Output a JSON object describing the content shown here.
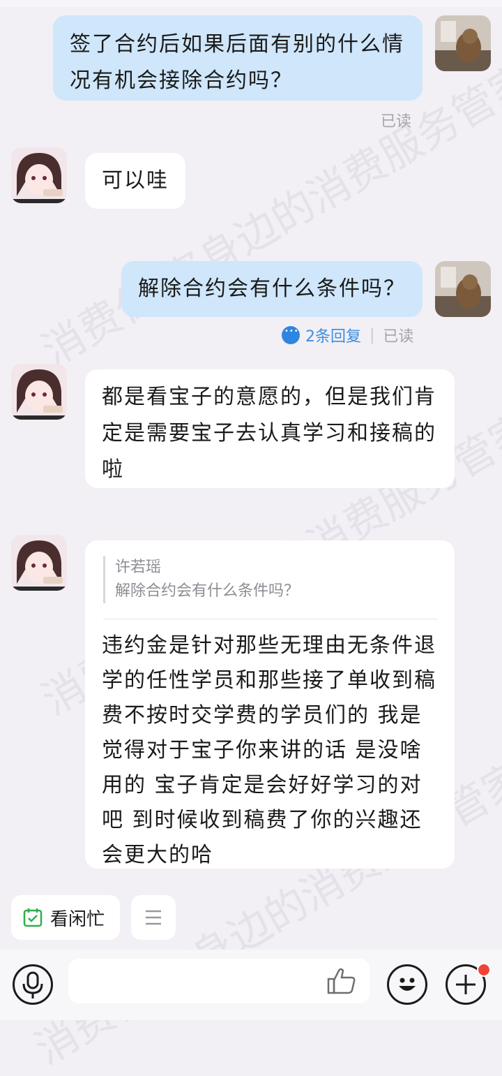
{
  "messages": [
    {
      "side": "me",
      "text": "签了合约后如果后面有别的什么情况有机会接除合约吗？",
      "status": "已读"
    },
    {
      "side": "them",
      "text": "可以哇"
    },
    {
      "side": "me",
      "text": "解除合约会有什么条件吗？",
      "replies": "2条回复",
      "status": "已读"
    },
    {
      "side": "them",
      "text": "都是看宝子的意愿的，但是我们肯定是需要宝子去认真学习和接稿的啦"
    },
    {
      "side": "them",
      "quote_name": "许若瑶",
      "quote_text": "解除合约会有什么条件吗？",
      "text": "违约金是针对那些无理由无条件退学的任性学员和那些接了单收到稿费不按时交学费的学员们的 我是觉得对于宝子你来讲的话 是没啥用的 宝子肯定是会好好学习的对吧 到时候收到稿费了你的兴趣还会更大的哈"
    }
  ],
  "chips": {
    "schedule_label": "看闲忙"
  },
  "watermark": "消费保 您身边的消费服务管家",
  "colors": {
    "my_bubble": "#cfe6fb",
    "their_bubble": "#ffffff",
    "link": "#3b8fe0",
    "badge": "#f0443a",
    "chip_icon": "#2fae4e"
  },
  "icons": [
    "voice-icon",
    "thumbs-up-icon",
    "emoji-icon",
    "plus-icon",
    "calendar-check-icon",
    "menu-icon",
    "reply-bubble-icon"
  ]
}
